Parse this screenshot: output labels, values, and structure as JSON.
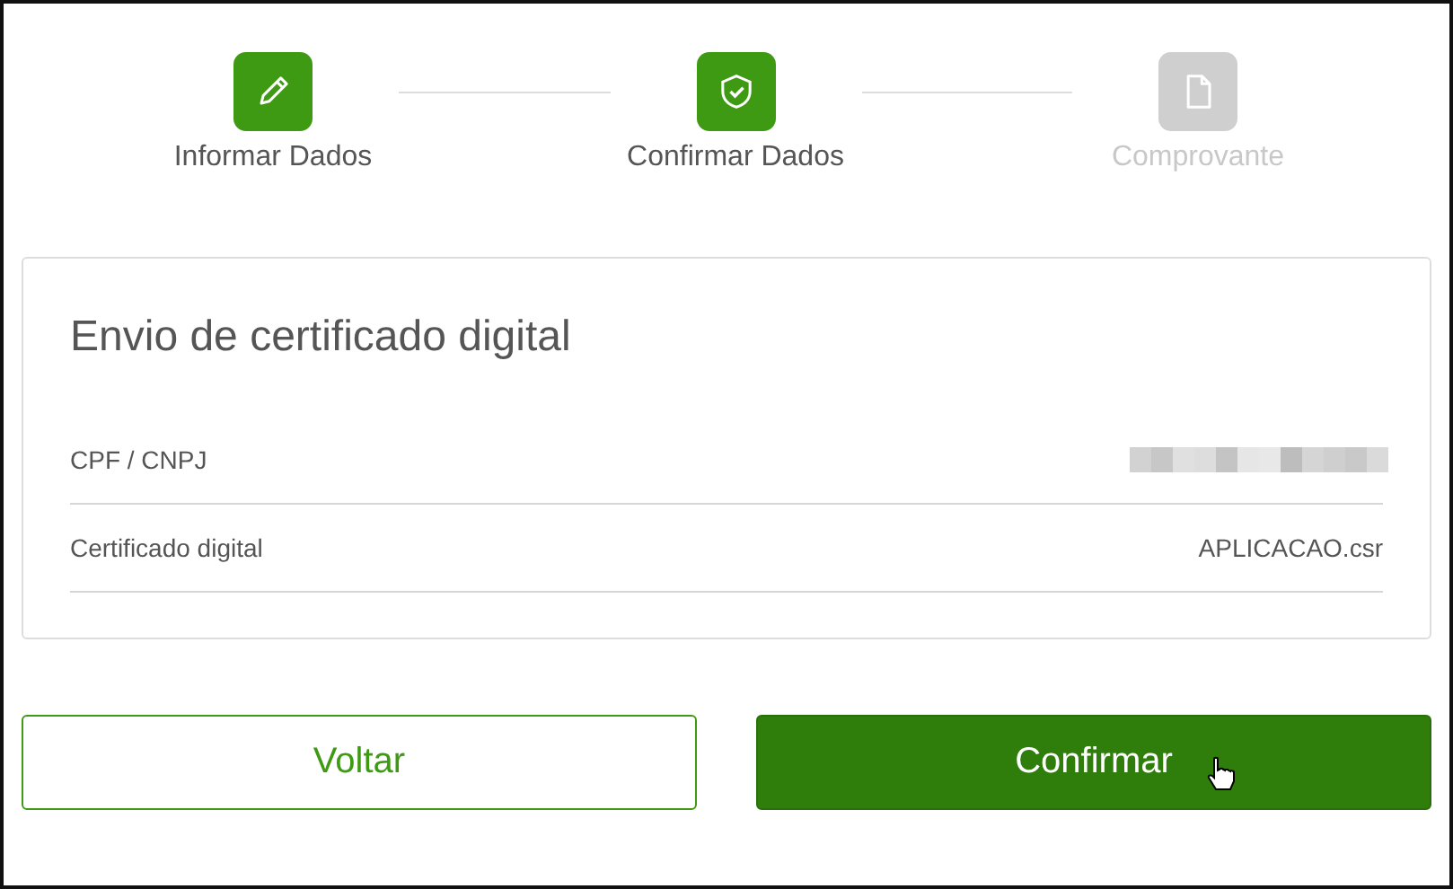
{
  "steps": [
    {
      "label": "Informar Dados",
      "completed": true
    },
    {
      "label": "Confirmar Dados",
      "completed": true
    },
    {
      "label": "Comprovante",
      "completed": false
    }
  ],
  "card": {
    "title": "Envio de certificado digital",
    "rows": [
      {
        "label": "CPF / CNPJ",
        "kind": "redacted"
      },
      {
        "label": "Certificado digital",
        "kind": "text",
        "value": "APLICACAO.csr"
      }
    ]
  },
  "buttons": [
    {
      "label": "Voltar",
      "kind": "outline"
    },
    {
      "label": "Confirmar",
      "kind": "primary"
    }
  ]
}
